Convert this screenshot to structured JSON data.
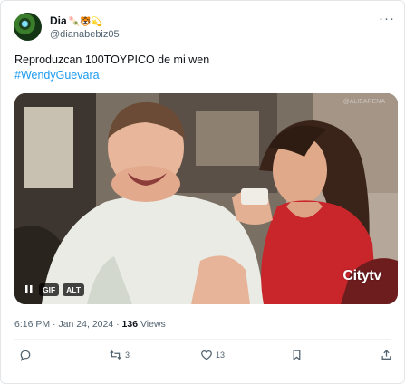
{
  "author": {
    "name": "Dia",
    "emojis": "🍡🐯💫",
    "handle": "@dianabebiz05"
  },
  "more_label": "···",
  "tweet": {
    "text": "Reproduzcan 100TOYPICO de mi wen",
    "hashtag": "#WendyGuevara"
  },
  "media": {
    "watermark": "@ALIEARENA",
    "badge_gif": "GIF",
    "badge_alt": "ALT",
    "overlay_logo": "Citytv"
  },
  "meta": {
    "time": "6:16 PM",
    "separator": " · ",
    "date": "Jan 24, 2024",
    "separator2": " · ",
    "views_count": "136",
    "views_label": " Views"
  },
  "actions": {
    "replies": "",
    "retweets": "3",
    "likes": "13"
  },
  "colors": {
    "text": "#0f1419",
    "secondary": "#536471",
    "link": "#1d9bf0",
    "border": "#e3e6e9"
  }
}
